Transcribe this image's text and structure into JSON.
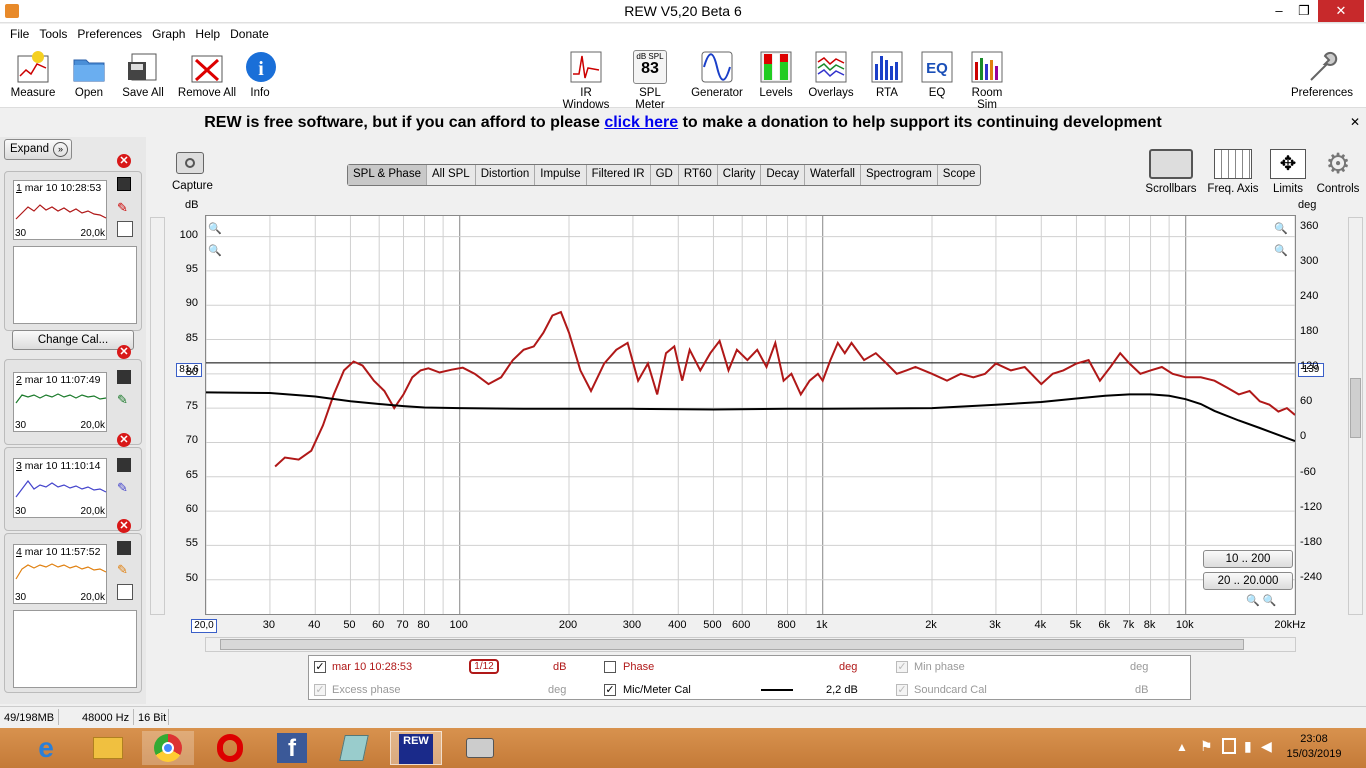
{
  "window": {
    "title": "REW V5,20 Beta 6",
    "minimize": "‒",
    "restore": "❐",
    "close": "✕"
  },
  "menu": [
    "File",
    "Tools",
    "Preferences",
    "Graph",
    "Help",
    "Donate"
  ],
  "toolbar": {
    "left": [
      "Measure",
      "Open",
      "Save All",
      "Remove All",
      "Info"
    ],
    "center": [
      "IR Windows",
      "SPL Meter",
      "Generator",
      "Levels",
      "Overlays",
      "RTA",
      "EQ",
      "Room Sim"
    ],
    "spl_meter_badge": "dB SPL",
    "spl_meter_value": "83",
    "right": "Preferences"
  },
  "banner": {
    "before": "REW is free software, but if you can afford to please ",
    "link": "click here",
    "after": " to make a donation to help support its continuing development",
    "close": "✕"
  },
  "left_panel": {
    "expand": "Expand",
    "change_cal": "Change Cal...",
    "measurements": [
      {
        "num": "1",
        "label": "mar 10 10:28:53",
        "lo": "30",
        "hi": "20,0k",
        "color": "#b01818"
      },
      {
        "num": "2",
        "label": "mar 10 11:07:49",
        "lo": "30",
        "hi": "20,0k",
        "color": "#1a7a2a"
      },
      {
        "num": "3",
        "label": "mar 10 11:10:14",
        "lo": "30",
        "hi": "20,0k",
        "color": "#4444cc"
      },
      {
        "num": "4",
        "label": "mar 10 11:57:52",
        "lo": "30",
        "hi": "20,0k",
        "color": "#e08010"
      }
    ]
  },
  "graph": {
    "capture": "Capture",
    "tabs": [
      "SPL & Phase",
      "All SPL",
      "Distortion",
      "Impulse",
      "Filtered IR",
      "GD",
      "RT60",
      "Clarity",
      "Decay",
      "Waterfall",
      "Spectrogram",
      "Scope"
    ],
    "selected_tab": "SPL & Phase",
    "right_tools": [
      "Scrollbars",
      "Freq. Axis",
      "Limits",
      "Controls"
    ],
    "y_left_unit": "dB",
    "y_right_unit": "deg",
    "y_left_ticks": [
      "100",
      "95",
      "90",
      "85",
      "80",
      "75",
      "70",
      "65",
      "60",
      "55",
      "50"
    ],
    "y_right_ticks": [
      "360",
      "300",
      "240",
      "180",
      "120",
      "60",
      "0",
      "-60",
      "-120",
      "-180",
      "-240"
    ],
    "x_ticks": [
      "30",
      "40",
      "50",
      "60",
      "70",
      "80",
      "100",
      "200",
      "300",
      "400",
      "500",
      "600",
      "800",
      "1k",
      "2k",
      "3k",
      "4k",
      "5k",
      "6k",
      "7k",
      "8k",
      "10k",
      "20kHz"
    ],
    "x_start": "20,0",
    "cursor_left": "81,6",
    "cursor_right": "139",
    "range_buttons": [
      "10 .. 200",
      "20 .. 20.000"
    ]
  },
  "legend": {
    "row1": [
      {
        "label": "mar 10 10:28:53",
        "unit": "dB",
        "smoothing": "1/12",
        "checked": true
      },
      {
        "label": "Phase",
        "unit": "deg",
        "checked": false
      },
      {
        "label": "Min phase",
        "unit": "deg",
        "disabled": true
      }
    ],
    "row2": [
      {
        "label": "Excess phase",
        "unit": "deg",
        "disabled": true
      },
      {
        "label": "Mic/Meter Cal",
        "value": "2,2 dB",
        "checked": true
      },
      {
        "label": "Soundcard Cal",
        "unit": "dB",
        "disabled": true
      }
    ]
  },
  "status": {
    "memory": "49/198MB",
    "rate": "48000 Hz",
    "bits": "16 Bit"
  },
  "taskbar": {
    "time": "23:08",
    "date": "15/03/2019",
    "rew_label": "REW"
  },
  "chart_data": {
    "type": "line",
    "x_scale": "log",
    "xlim": [
      20,
      20000
    ],
    "ylim": [
      45,
      103
    ],
    "ylabel": "dB",
    "y2label": "deg",
    "y2lim": [
      -300,
      380
    ],
    "grid": true,
    "series": [
      {
        "color": "#b01818",
        "x": [
          31,
          33,
          36,
          39,
          42,
          45,
          48,
          51,
          54,
          58,
          62,
          66,
          70,
          74,
          78,
          82,
          88,
          95,
          102,
          110,
          120,
          130,
          140,
          150,
          160,
          170,
          180,
          190,
          200,
          215,
          230,
          250,
          270,
          290,
          310,
          330,
          350,
          370,
          390,
          410,
          430,
          460,
          490,
          520,
          550,
          580,
          620,
          660,
          700,
          740,
          780,
          820,
          870,
          920,
          970,
          1000,
          1050,
          1100,
          1150,
          1200,
          1300,
          1400,
          1500,
          1600,
          1700,
          1800,
          2000,
          2200,
          2400,
          2600,
          2800,
          3000,
          3300,
          3600,
          4000,
          4300,
          4600,
          5000,
          5400,
          5800,
          6200,
          6600,
          7000,
          7500,
          8000,
          8600,
          9200,
          10000,
          11000,
          12000,
          13000,
          14000,
          15000,
          16000,
          17000,
          18000,
          19000,
          20000
        ],
        "y": [
          66.5,
          67.8,
          67.5,
          68.8,
          72.5,
          77,
          80.5,
          81.8,
          81.2,
          79,
          77.5,
          75,
          77,
          79.5,
          80.5,
          80.8,
          80.2,
          80.6,
          80.9,
          80,
          78.5,
          79.5,
          82,
          83.5,
          84,
          86,
          88.5,
          89,
          86,
          80.5,
          77.5,
          81.5,
          83.5,
          84.5,
          79,
          81.5,
          77,
          83,
          84,
          79,
          83.5,
          80.5,
          83,
          84.8,
          80.5,
          83.5,
          82,
          83.5,
          81,
          84.5,
          79,
          80,
          77,
          79,
          80,
          79,
          82,
          84.5,
          83,
          84.5,
          82,
          83,
          81.5,
          80,
          80.5,
          81,
          80,
          79,
          80,
          79.5,
          80,
          81.5,
          80.5,
          81,
          78.5,
          80,
          80.5,
          81.5,
          82,
          79,
          81,
          83,
          81.5,
          80,
          80.5,
          81,
          80,
          79.5,
          79.5,
          79,
          78,
          77,
          77.5,
          76,
          75.5,
          74.5,
          75,
          74
        ]
      },
      {
        "color": "#000000",
        "x": [
          20,
          30,
          40,
          50,
          60,
          70,
          80,
          100,
          150,
          200,
          300,
          500,
          800,
          1000,
          2000,
          3000,
          4000,
          5000,
          6000,
          7000,
          8000,
          9000,
          10000,
          11000,
          12000,
          14000,
          16000,
          18000,
          20000
        ],
        "y": [
          77.3,
          77.2,
          76.7,
          76.0,
          75.6,
          75.3,
          75.1,
          75.0,
          74.9,
          74.9,
          74.9,
          74.8,
          74.9,
          74.9,
          75.0,
          75.5,
          75.9,
          76.4,
          76.8,
          77.0,
          77.0,
          76.8,
          76.3,
          75.6,
          74.6,
          73.2,
          72.1,
          71.1,
          70.2
        ]
      }
    ]
  }
}
